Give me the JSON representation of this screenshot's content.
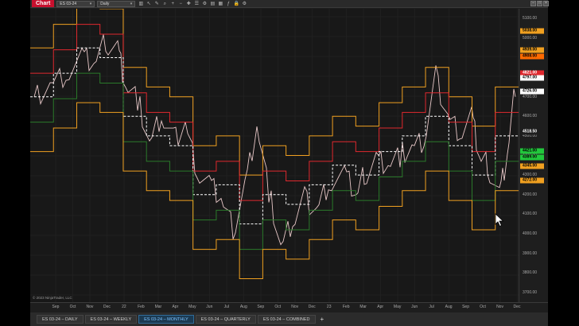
{
  "toolbar": {
    "chart_tab_label": "Chart",
    "instrument_value": "ES 03-24",
    "interval_value": "Daily",
    "tool_icons": [
      "bar-chart-icon",
      "cursor-icon",
      "draw-tool-icon",
      "magnify-icon",
      "zoom-in-icon",
      "zoom-out-icon",
      "crosshair-icon",
      "properties-icon",
      "strategy-icon",
      "template-icon",
      "layout-icon",
      "indicator-icon",
      "lock-icon",
      "settings-icon"
    ]
  },
  "window_buttons": [
    "minimize-icon",
    "maximize-icon",
    "close-icon"
  ],
  "price_axis": {
    "ticks": [
      "5100.00",
      "5000.00",
      "4900.00",
      "4800.00",
      "4700.00",
      "4600.00",
      "4500.00",
      "4400.00",
      "4300.00",
      "4200.00",
      "4100.00",
      "4000.00",
      "3900.00",
      "3800.00",
      "3700.00"
    ],
    "tags": [
      {
        "label": "5038.00",
        "color": "#f0a020",
        "text": "#000"
      },
      {
        "label": "4939.00",
        "color": "#f0a020",
        "text": "#000"
      },
      {
        "label": "4908.00",
        "color": "#ff6a00",
        "text": "#000"
      },
      {
        "label": "4821.00",
        "color": "#e0282e",
        "text": "#fff"
      },
      {
        "label": "4797.00",
        "color": "#ffffff",
        "text": "#000"
      },
      {
        "label": "4726.00",
        "color": "#ffffff",
        "text": "#000"
      },
      {
        "label": "4518.50",
        "color": "#1e1e1e",
        "text": "#fff"
      },
      {
        "label": "4421.00",
        "color": "#22c83c",
        "text": "#000"
      },
      {
        "label": "4389.00",
        "color": "#22c83c",
        "text": "#000"
      },
      {
        "label": "4345.00",
        "color": "#f0a020",
        "text": "#000"
      },
      {
        "label": "4272.00",
        "color": "#f0a020",
        "text": "#000"
      }
    ]
  },
  "time_axis": {
    "ticks": [
      "Sep",
      "Oct",
      "Nov",
      "Dec",
      "22",
      "Feb",
      "Mar",
      "Apr",
      "May",
      "Jun",
      "Jul",
      "Aug",
      "Sep",
      "Oct",
      "Nov",
      "Dec",
      "23",
      "Feb",
      "Mar",
      "Apr",
      "May",
      "Jun",
      "Jul",
      "Aug",
      "Sep",
      "Oct",
      "Nov",
      "Dec"
    ]
  },
  "copyright": "© 2023 NinjaTrader, LLC",
  "tabs": [
    {
      "label": "ES 03-24 – DAILY",
      "active": false
    },
    {
      "label": "ES 03-24 – WEEKLY",
      "active": false
    },
    {
      "label": "ES 03-24 – MONTHLY",
      "active": true
    },
    {
      "label": "ES 03-24 – QUARTERLY",
      "active": false
    },
    {
      "label": "ES 03-24 – COMBINED",
      "active": false
    }
  ],
  "add_tab_label": "+",
  "colors": {
    "background": "#181818",
    "price_line": "#e8c8c8",
    "monthly_open": "#ffffff",
    "upper_band": "#f0a020",
    "mid_high": "#e0282e",
    "mid_low": "#2a7a2a",
    "lower_band": "#f0a020",
    "accent_tab": "#7ec3ff"
  }
}
